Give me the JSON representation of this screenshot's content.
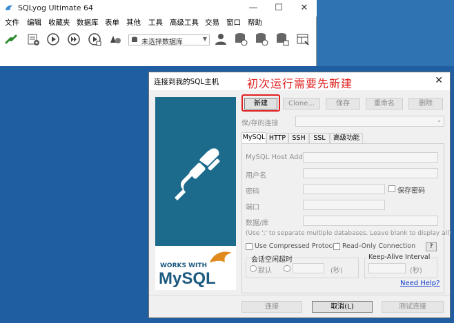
{
  "app": {
    "title": "SQLyog Ultimate 64",
    "window_controls": {
      "minimize": "—",
      "maximize": "☐",
      "close": "✕"
    },
    "menu": [
      "文件",
      "编辑",
      "收藏夹",
      "数据库",
      "表单",
      "其他",
      "工具",
      "高级工具",
      "交易",
      "窗口",
      "帮助"
    ],
    "db_select": {
      "value": "未选择数据库"
    }
  },
  "dialog": {
    "title": "连接到我的SQL主机",
    "close": "✕",
    "annotation": "初次运行需要先新建",
    "buttons": {
      "new": "新建",
      "clone": "Clone...",
      "save": "保存",
      "rename": "重命名",
      "delete": "删除"
    },
    "saved_connections_label": "保/存的连接",
    "tabs": [
      "MySQL",
      "HTTP",
      "SSH",
      "SSL",
      "高级功能"
    ],
    "form": {
      "host_label": "MySQL Host Address",
      "user_label": "用户名",
      "password_label": "密码",
      "save_password_label": "保存密码",
      "port_label": "端口",
      "database_label": "数据/库",
      "hint": "(Use ';' to separate multiple databases. Leave blank to display all)",
      "compressed_label": "Use Compressed Protocol",
      "readonly_label": "Read-Only Connection",
      "help": "?",
      "session_timeout_label": "会话空闲超时",
      "default_label": "默认",
      "seconds_label": "(秒)",
      "keepalive_label": "Keep-Alive Interval",
      "need_help": "Need Help?"
    },
    "banner": {
      "works_with": "WORKS WITH",
      "mysql": "MySQL"
    },
    "footer": {
      "connect": "连接",
      "cancel": "取消(L)",
      "test": "测试连接"
    }
  },
  "colors": {
    "accent_red": "#e02020",
    "banner_blue": "#1d6b8c",
    "link_blue": "#0a36c9"
  }
}
